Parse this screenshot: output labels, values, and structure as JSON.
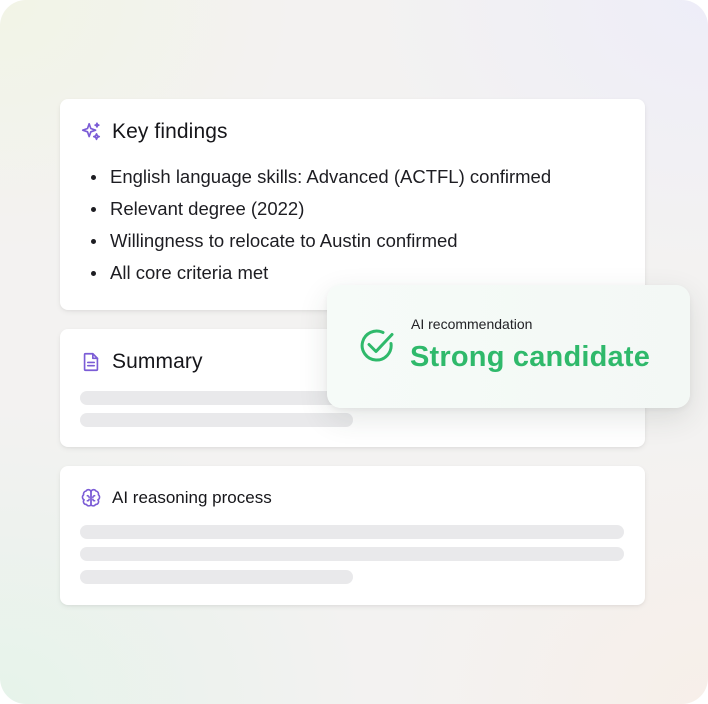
{
  "key_findings": {
    "title": "Key findings",
    "icon": "sparkle-icon",
    "items": [
      "English language skills: Advanced (ACTFL) confirmed",
      "Relevant degree (2022)",
      "Willingness to relocate to Austin confirmed",
      "All core criteria met"
    ]
  },
  "summary": {
    "title": "Summary",
    "icon": "document-icon"
  },
  "reasoning": {
    "title": "AI reasoning process",
    "icon": "brain-icon"
  },
  "recommendation": {
    "label": "AI recommendation",
    "value": "Strong candidate",
    "icon": "check-circle-icon",
    "color": "#2fb96b"
  },
  "colors": {
    "accent_purple": "#7b5cd6",
    "success_green": "#2fb96b",
    "placeholder_gray": "#e9e9eb"
  }
}
